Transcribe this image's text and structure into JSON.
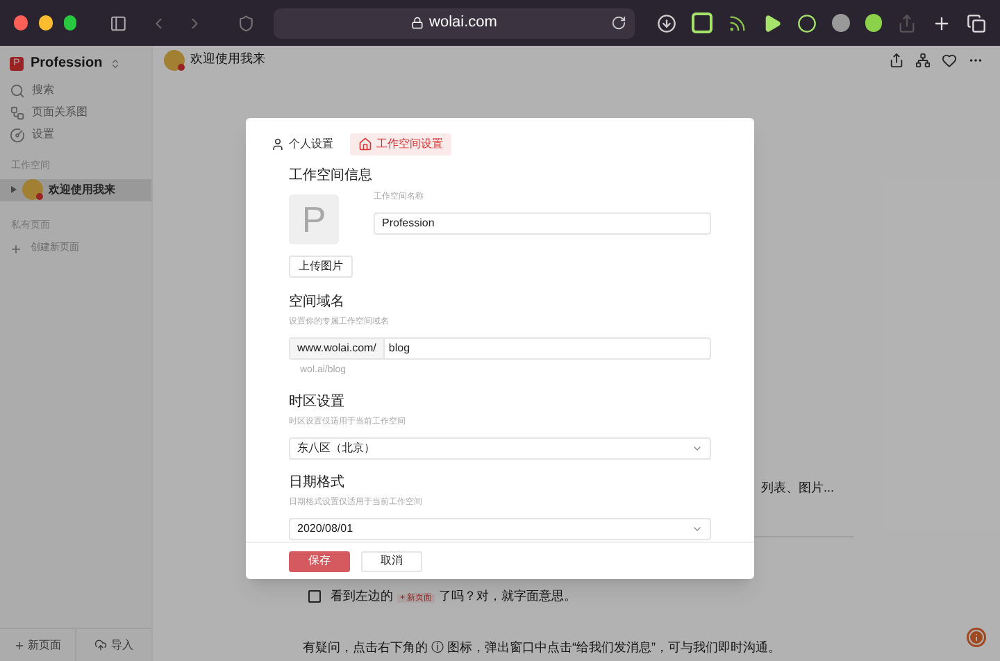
{
  "browser": {
    "url": "wolai.com"
  },
  "sidebar": {
    "workspace_initial": "P",
    "workspace_name": "Profession",
    "nav": [
      {
        "kind": "search",
        "label": "搜索"
      },
      {
        "kind": "graph",
        "label": "页面关系图"
      },
      {
        "kind": "settings",
        "label": "设置"
      }
    ],
    "workspace_section": {
      "title": "工作空间",
      "pages": [
        {
          "label": "欢迎使用我来",
          "selected": true
        }
      ]
    },
    "private_section": {
      "title": "私有页面",
      "create_label": "创建新页面"
    },
    "footer": {
      "new_page": "新页面",
      "import": "导入"
    }
  },
  "page": {
    "title": "欢迎使用我来",
    "partial_line": "列表、图片...",
    "todo": {
      "checked": false,
      "before": "看到左边的",
      "chip": "+ 新页面",
      "after": "了吗？对，就字面意思。"
    },
    "paragraph": "有疑问，点击右下角的 ⓘ 图标，弹出窗口中点击“给我们发消息”，可与我们即时沟通。"
  },
  "dialog": {
    "tabs": [
      {
        "kind": "user",
        "label": "个人设置",
        "selected": false
      },
      {
        "kind": "home",
        "label": "工作空间设置",
        "selected": true
      }
    ],
    "info": {
      "heading": "工作空间信息",
      "avatar_letter": "P",
      "name_label": "工作空间名称",
      "name_value": "Profession",
      "upload_button": "上传图片"
    },
    "domain": {
      "heading": "空间域名",
      "hint": "设置你的专属工作空间域名",
      "prefix": "www.wolai.com/",
      "value": "blog",
      "short_link": "wol.ai/blog"
    },
    "timezone": {
      "heading": "时区设置",
      "hint": "时区设置仅适用于当前工作空间",
      "value": "东八区（北京）"
    },
    "date_format": {
      "heading": "日期格式",
      "hint": "日期格式设置仅适用于当前工作空间",
      "value": "2020/08/01"
    },
    "buttons": [
      {
        "kind": "primary",
        "label": "保存"
      },
      {
        "kind": "secondary",
        "label": "取消"
      }
    ]
  }
}
